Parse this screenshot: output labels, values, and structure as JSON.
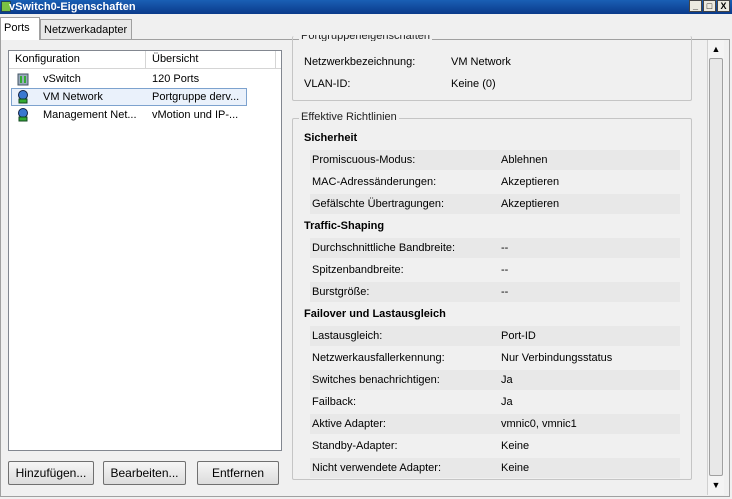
{
  "window": {
    "title": "vSwitch0-Eigenschaften",
    "btn_min": "_",
    "btn_max": "□",
    "btn_close": "X"
  },
  "tabs": [
    {
      "label": "Ports"
    },
    {
      "label": "Netzwerkadapter"
    }
  ],
  "list": {
    "headers": [
      "Konfiguration",
      "Übersicht"
    ],
    "rows": [
      {
        "name": "vSwitch",
        "summary": "120 Ports",
        "icon": "vswitch-icon"
      },
      {
        "name": "VM Network",
        "summary": "Portgruppe derv...",
        "icon": "port-group-icon"
      },
      {
        "name": "Management Net...",
        "summary": "vMotion und IP-...",
        "icon": "port-group-icon"
      }
    ]
  },
  "buttons": {
    "add": "Hinzufügen...",
    "edit": "Bearbeiten...",
    "remove": "Entfernen"
  },
  "portgroup": {
    "title": "Portgruppeneigenschaften",
    "fields": [
      {
        "label": "Netzwerkbezeichnung:",
        "value": "VM Network"
      },
      {
        "label": "VLAN-ID:",
        "value": "Keine (0)"
      }
    ]
  },
  "policies": {
    "title": "Effektive Richtlinien",
    "security": {
      "heading": "Sicherheit",
      "fields": [
        {
          "label": "Promiscuous-Modus:",
          "value": "Ablehnen"
        },
        {
          "label": "MAC-Adressänderungen:",
          "value": "Akzeptieren"
        },
        {
          "label": "Gefälschte Übertragungen:",
          "value": "Akzeptieren"
        }
      ]
    },
    "traffic": {
      "heading": "Traffic-Shaping",
      "fields": [
        {
          "label": "Durchschnittliche Bandbreite:",
          "value": "--"
        },
        {
          "label": "Spitzenbandbreite:",
          "value": "--"
        },
        {
          "label": "Burstgröße:",
          "value": "--"
        }
      ]
    },
    "failover": {
      "heading": "Failover und Lastausgleich",
      "fields": [
        {
          "label": "Lastausgleich:",
          "value": "Port-ID"
        },
        {
          "label": "Netzwerkausfallerkennung:",
          "value": "Nur Verbindungsstatus"
        },
        {
          "label": "Switches benachrichtigen:",
          "value": "Ja"
        },
        {
          "label": "Failback:",
          "value": "Ja"
        },
        {
          "label": "Aktive Adapter:",
          "value": "vmnic0, vmnic1"
        },
        {
          "label": "Standby-Adapter:",
          "value": "Keine"
        },
        {
          "label": "Nicht verwendete Adapter:",
          "value": "Keine"
        }
      ]
    }
  },
  "scrollbar": {
    "up": "▲",
    "down": "▼"
  }
}
